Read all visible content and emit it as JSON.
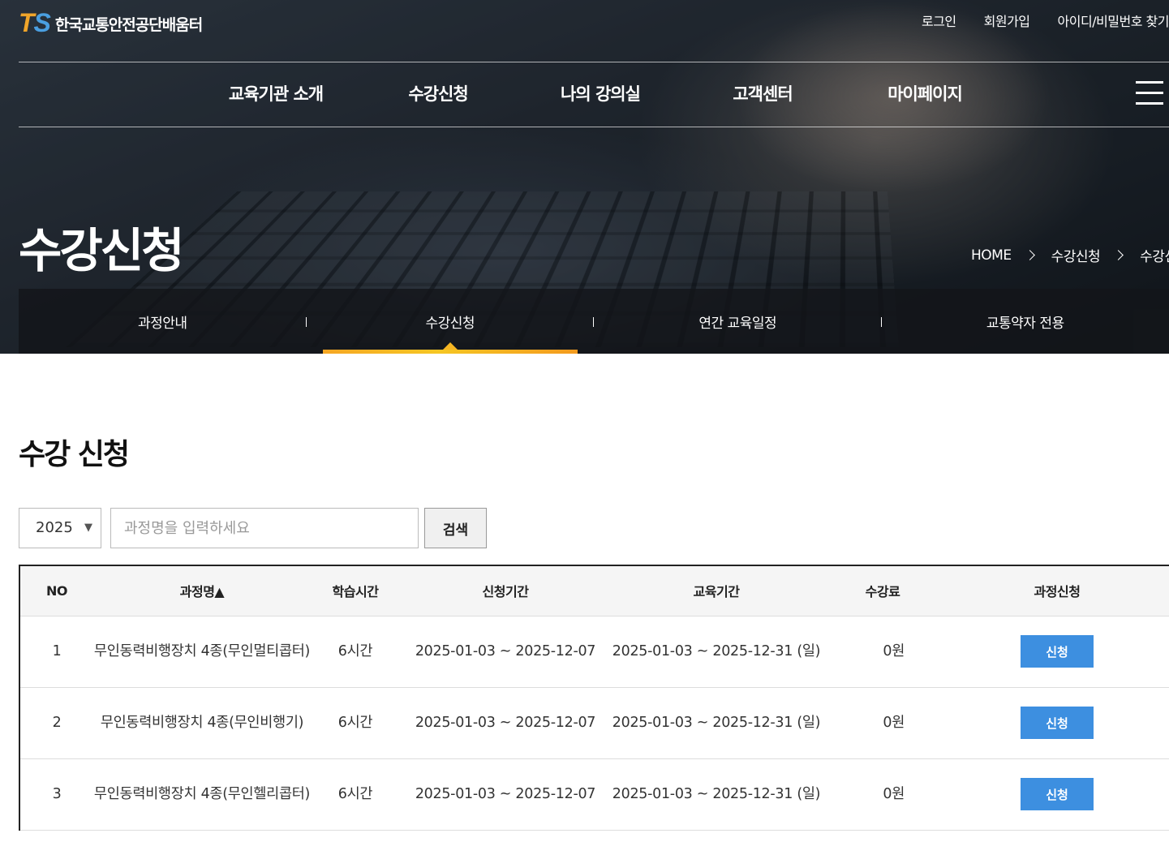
{
  "header": {
    "logo_mark_t": "T",
    "logo_mark_s": "S",
    "logo_text": "한국교통안전공단배움터",
    "util_links": [
      "로그인",
      "회원가입",
      "아이디/비밀번호 찾기"
    ],
    "gnb": [
      "교육기관 소개",
      "수강신청",
      "나의 강의실",
      "고객센터",
      "마이페이지"
    ]
  },
  "hero": {
    "title": "수강신청",
    "breadcrumb": [
      "HOME",
      "수강신청",
      "수강신청"
    ]
  },
  "lnb": {
    "items": [
      "과정안내",
      "수강신청",
      "연간 교육일정",
      "교통약자 전용"
    ],
    "active_index": 1
  },
  "main": {
    "section_title": "수강 신청",
    "search": {
      "year": "2025",
      "year_arrow": "▼",
      "placeholder": "과정명을 입력하세요",
      "button": "검색"
    },
    "table": {
      "headers": [
        "NO",
        "과정명▲",
        "학습시간",
        "신청기간",
        "교육기간",
        "수강료",
        "과정신청"
      ],
      "rows": [
        {
          "no": "1",
          "course": "무인동력비행장치 4종(무인멀티콥터)",
          "hours": "6시간",
          "apply_period": "2025-01-03 ~ 2025-12-07",
          "edu_period": "2025-01-03 ~ 2025-12-31 (일)",
          "fee": "0원",
          "action": "신청"
        },
        {
          "no": "2",
          "course": "무인동력비행장치 4종(무인비행기)",
          "hours": "6시간",
          "apply_period": "2025-01-03 ~ 2025-12-07",
          "edu_period": "2025-01-03 ~ 2025-12-31 (일)",
          "fee": "0원",
          "action": "신청"
        },
        {
          "no": "3",
          "course": "무인동력비행장치 4종(무인헬리콥터)",
          "hours": "6시간",
          "apply_period": "2025-01-03 ~ 2025-12-07",
          "edu_period": "2025-01-03 ~ 2025-12-31 (일)",
          "fee": "0원",
          "action": "신청"
        }
      ]
    }
  },
  "colors": {
    "accent_orange": "#f5a623",
    "button_blue": "#3d8fe0",
    "logo_t": "#f0a52a",
    "logo_s": "#4a9fe0"
  }
}
